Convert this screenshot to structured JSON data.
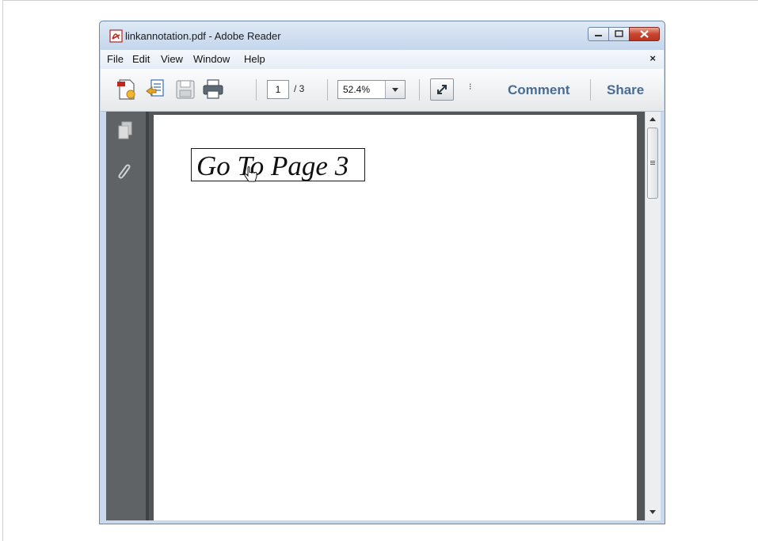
{
  "window": {
    "title": "linkannotation.pdf - Adobe Reader"
  },
  "menu": {
    "items": [
      "File",
      "Edit",
      "View",
      "Window",
      "Help"
    ],
    "close_glyph": "×"
  },
  "toolbar": {
    "page_current": "1",
    "page_total": "/ 3",
    "zoom": "52.4%",
    "more_glyph": "⁝",
    "comment_label": "Comment",
    "share_label": "Share"
  },
  "document": {
    "link_text": "Go To Page 3"
  },
  "colors": {
    "accent_link": "#4b6c91",
    "window_frame": "#c9daee",
    "close_red": "#c9452f",
    "nav_pane": "#5f6366",
    "viewer_bg": "#525659"
  }
}
